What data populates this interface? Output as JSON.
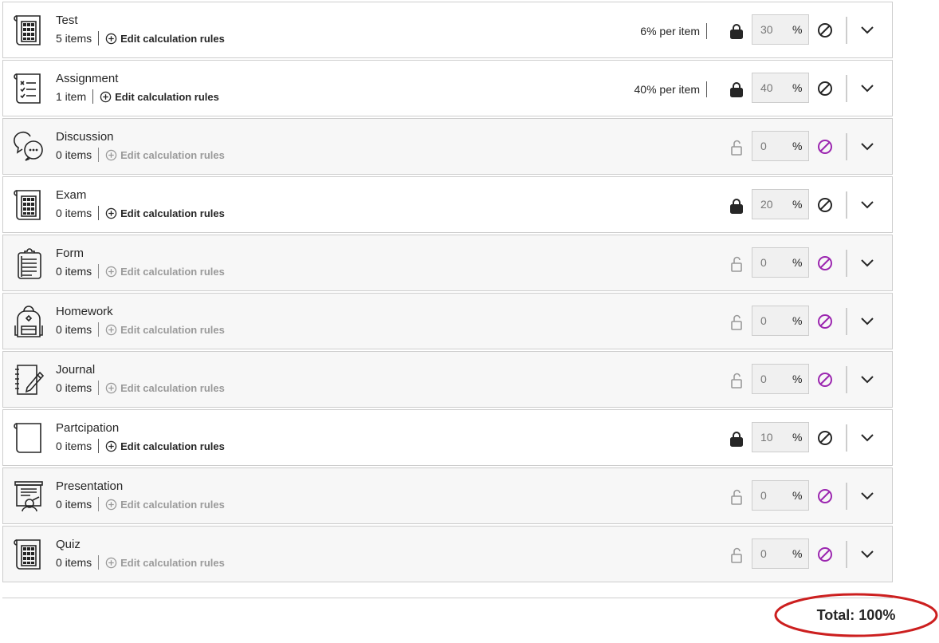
{
  "categories": [
    {
      "name": "Test",
      "count": "5 items",
      "edit_label": "Edit calculation rules",
      "per_item": "6% per item",
      "weight": "30",
      "locked": true,
      "excluded": false,
      "icon": "calculator-icon"
    },
    {
      "name": "Assignment",
      "count": "1 item",
      "edit_label": "Edit calculation rules",
      "per_item": "40% per item",
      "weight": "40",
      "locked": true,
      "excluded": false,
      "icon": "checklist-icon"
    },
    {
      "name": "Discussion",
      "count": "0 items",
      "edit_label": "Edit calculation rules",
      "per_item": "",
      "weight": "0",
      "locked": false,
      "excluded": true,
      "icon": "chat-bubbles-icon"
    },
    {
      "name": "Exam",
      "count": "0 items",
      "edit_label": "Edit calculation rules",
      "per_item": "",
      "weight": "20",
      "locked": true,
      "excluded": false,
      "icon": "calculator-icon"
    },
    {
      "name": "Form",
      "count": "0 items",
      "edit_label": "Edit calculation rules",
      "per_item": "",
      "weight": "0",
      "locked": false,
      "excluded": true,
      "icon": "clipboard-icon"
    },
    {
      "name": "Homework",
      "count": "0 items",
      "edit_label": "Edit calculation rules",
      "per_item": "",
      "weight": "0",
      "locked": false,
      "excluded": true,
      "icon": "backpack-icon"
    },
    {
      "name": "Journal",
      "count": "0 items",
      "edit_label": "Edit calculation rules",
      "per_item": "",
      "weight": "0",
      "locked": false,
      "excluded": true,
      "icon": "notebook-pencil-icon"
    },
    {
      "name": "Partcipation",
      "count": "0 items",
      "edit_label": "Edit calculation rules",
      "per_item": "",
      "weight": "10",
      "locked": true,
      "excluded": false,
      "icon": "blank-page-icon"
    },
    {
      "name": "Presentation",
      "count": "0 items",
      "edit_label": "Edit calculation rules",
      "per_item": "",
      "weight": "0",
      "locked": false,
      "excluded": true,
      "icon": "presentation-icon"
    },
    {
      "name": "Quiz",
      "count": "0 items",
      "edit_label": "Edit calculation rules",
      "per_item": "",
      "weight": "0",
      "locked": false,
      "excluded": true,
      "icon": "calculator-icon"
    }
  ],
  "percent_symbol": "%",
  "total": "Total: 100%",
  "colors": {
    "exclude_active": "#262626",
    "exclude_disabled": "#9c27b0",
    "lock_open": "#9a9a9a",
    "highlight_circle": "#cc1f1f"
  }
}
